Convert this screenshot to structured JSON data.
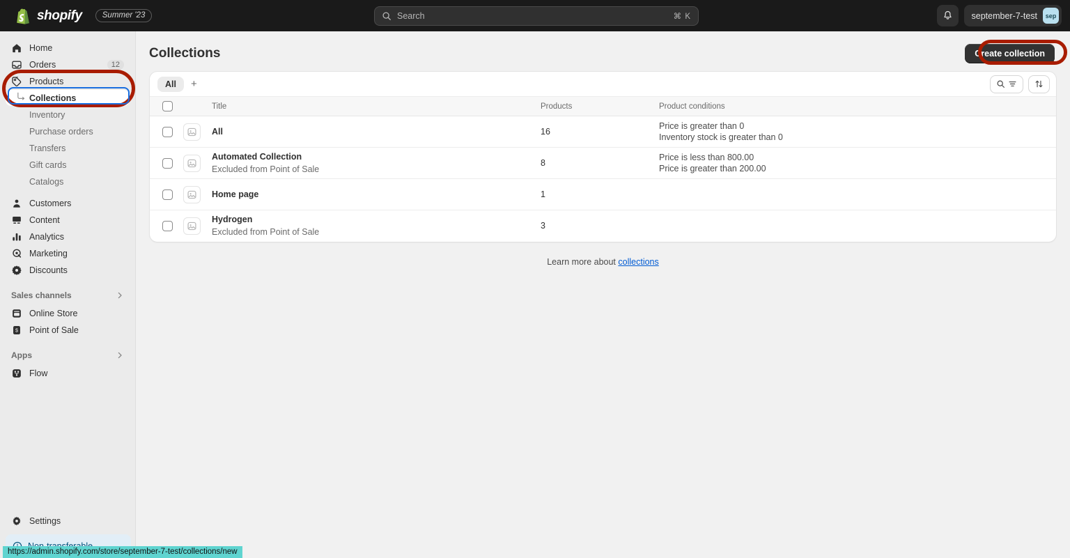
{
  "topbar": {
    "brand_word": "shopify",
    "brand_icon": "shopify-bag-icon",
    "season_pill": "Summer '23",
    "search": {
      "icon": "search-icon",
      "placeholder": "Search",
      "value": "",
      "shortcut": "⌘ K"
    },
    "notifications_icon": "bell-icon",
    "store_name": "september-7-test",
    "avatar_initials": "sep"
  },
  "sidebar": {
    "items": [
      {
        "label": "Home",
        "icon": "home-icon",
        "badge": ""
      },
      {
        "label": "Orders",
        "icon": "orders-box-icon",
        "badge": "12"
      },
      {
        "label": "Products",
        "icon": "products-tag-icon",
        "badge": ""
      }
    ],
    "product_subitems": [
      {
        "label": "Collections",
        "selected": true
      },
      {
        "label": "Inventory",
        "selected": false
      },
      {
        "label": "Purchase orders",
        "selected": false
      },
      {
        "label": "Transfers",
        "selected": false
      },
      {
        "label": "Gift cards",
        "selected": false
      },
      {
        "label": "Catalogs",
        "selected": false
      }
    ],
    "items2": [
      {
        "label": "Customers",
        "icon": "customers-person-icon"
      },
      {
        "label": "Content",
        "icon": "content-icon"
      },
      {
        "label": "Analytics",
        "icon": "analytics-bars-icon"
      },
      {
        "label": "Marketing",
        "icon": "marketing-megaphone-icon"
      },
      {
        "label": "Discounts",
        "icon": "discounts-tag-icon"
      }
    ],
    "sales_channels": {
      "label": "Sales channels",
      "chevron": "chevron-right-icon",
      "items": [
        {
          "label": "Online Store",
          "icon": "online-store-icon"
        },
        {
          "label": "Point of Sale",
          "icon": "point-of-sale-icon"
        }
      ]
    },
    "apps": {
      "label": "Apps",
      "chevron": "chevron-right-icon",
      "items": [
        {
          "label": "Flow",
          "icon": "flow-icon"
        }
      ]
    },
    "settings": {
      "label": "Settings",
      "icon": "gear-icon"
    },
    "non_transferable": {
      "label": "Non-transferable",
      "icon": "info-circle-icon"
    }
  },
  "page": {
    "title": "Collections",
    "create_button": "Create collection"
  },
  "card": {
    "tabs": [
      {
        "label": "All",
        "active": true
      }
    ],
    "add_tab_label": "+",
    "search_icon": "search-icon",
    "filter_icon": "filter-icon",
    "sort_icon": "sort-arrows-icon",
    "columns": [
      "",
      "",
      "Title",
      "Products",
      "Product conditions"
    ],
    "rows": [
      {
        "thumb_icon": "image-placeholder-icon",
        "title": "All",
        "subtitle": "",
        "products": "16",
        "conditions": [
          "Price is greater than 0",
          "Inventory stock is greater than 0"
        ]
      },
      {
        "thumb_icon": "image-placeholder-icon",
        "title": "Automated Collection",
        "subtitle": "Excluded from Point of Sale",
        "products": "8",
        "conditions": [
          "Price is less than 800.00",
          "Price is greater than 200.00"
        ]
      },
      {
        "thumb_icon": "image-placeholder-icon",
        "title": "Home page",
        "subtitle": "",
        "products": "1",
        "conditions": []
      },
      {
        "thumb_icon": "image-placeholder-icon",
        "title": "Hydrogen",
        "subtitle": "Excluded from Point of Sale",
        "products": "3",
        "conditions": []
      }
    ]
  },
  "footer": {
    "learn_more_prefix": "Learn more about ",
    "learn_more_link": "collections"
  },
  "status_bar": {
    "url": "https://admin.shopify.com/store/september-7-test/collections/new"
  },
  "annotations": {
    "highlight_color": "#a81c00",
    "focus_color": "#1a6fe0"
  }
}
